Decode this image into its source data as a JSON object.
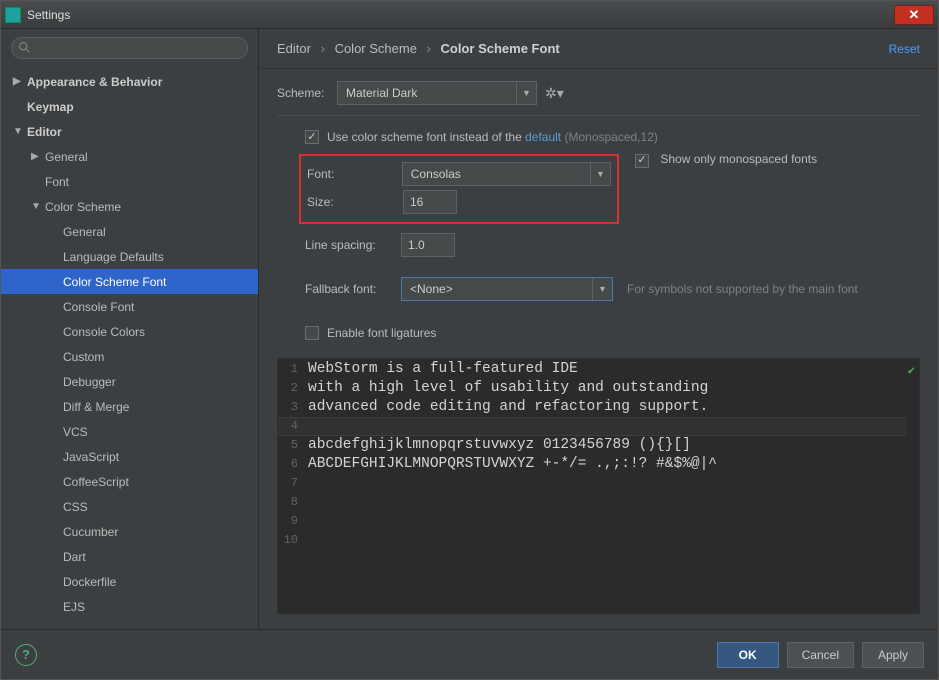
{
  "window": {
    "title": "Settings"
  },
  "breadcrumb": {
    "a": "Editor",
    "b": "Color Scheme",
    "c": "Color Scheme Font",
    "reset": "Reset"
  },
  "scheme": {
    "label": "Scheme:",
    "value": "Material Dark"
  },
  "useSchemeFont": {
    "prefix": "Use color scheme font instead of the ",
    "link": "default",
    "suffix": " (Monospaced,12)"
  },
  "font": {
    "label": "Font:",
    "value": "Consolas"
  },
  "showMono": {
    "label": "Show only monospaced fonts"
  },
  "size": {
    "label": "Size:",
    "value": "16"
  },
  "lineSpacing": {
    "label": "Line spacing:",
    "value": "1.0"
  },
  "fallback": {
    "label": "Fallback font:",
    "value": "<None>",
    "hint": "For symbols not supported by the main font"
  },
  "ligatures": {
    "label": "Enable font ligatures"
  },
  "preview": {
    "lines": [
      "WebStorm is a full-featured IDE",
      "with a high level of usability and outstanding",
      "advanced code editing and refactoring support.",
      "",
      "abcdefghijklmnopqrstuvwxyz 0123456789 (){}[]",
      "ABCDEFGHIJKLMNOPQRSTUVWXYZ +-*/= .,;:!? #&$%@|^",
      "",
      "",
      "",
      ""
    ]
  },
  "sidebar": {
    "items": [
      {
        "label": "Appearance & Behavior",
        "indent": 1,
        "bold": true,
        "arrow": "right"
      },
      {
        "label": "Keymap",
        "indent": 1,
        "bold": true,
        "arrow": ""
      },
      {
        "label": "Editor",
        "indent": 1,
        "bold": true,
        "arrow": "down"
      },
      {
        "label": "General",
        "indent": 2,
        "bold": false,
        "arrow": "right"
      },
      {
        "label": "Font",
        "indent": 2,
        "bold": false,
        "arrow": ""
      },
      {
        "label": "Color Scheme",
        "indent": 2,
        "bold": false,
        "arrow": "down"
      },
      {
        "label": "General",
        "indent": 3,
        "bold": false,
        "arrow": ""
      },
      {
        "label": "Language Defaults",
        "indent": 3,
        "bold": false,
        "arrow": ""
      },
      {
        "label": "Color Scheme Font",
        "indent": 3,
        "bold": false,
        "arrow": "",
        "selected": true
      },
      {
        "label": "Console Font",
        "indent": 3,
        "bold": false,
        "arrow": ""
      },
      {
        "label": "Console Colors",
        "indent": 3,
        "bold": false,
        "arrow": ""
      },
      {
        "label": "Custom",
        "indent": 3,
        "bold": false,
        "arrow": ""
      },
      {
        "label": "Debugger",
        "indent": 3,
        "bold": false,
        "arrow": ""
      },
      {
        "label": "Diff & Merge",
        "indent": 3,
        "bold": false,
        "arrow": ""
      },
      {
        "label": "VCS",
        "indent": 3,
        "bold": false,
        "arrow": ""
      },
      {
        "label": "JavaScript",
        "indent": 3,
        "bold": false,
        "arrow": ""
      },
      {
        "label": "CoffeeScript",
        "indent": 3,
        "bold": false,
        "arrow": ""
      },
      {
        "label": "CSS",
        "indent": 3,
        "bold": false,
        "arrow": ""
      },
      {
        "label": "Cucumber",
        "indent": 3,
        "bold": false,
        "arrow": ""
      },
      {
        "label": "Dart",
        "indent": 3,
        "bold": false,
        "arrow": ""
      },
      {
        "label": "Dockerfile",
        "indent": 3,
        "bold": false,
        "arrow": ""
      },
      {
        "label": "EJS",
        "indent": 3,
        "bold": false,
        "arrow": ""
      }
    ]
  },
  "buttons": {
    "ok": "OK",
    "cancel": "Cancel",
    "apply": "Apply"
  }
}
